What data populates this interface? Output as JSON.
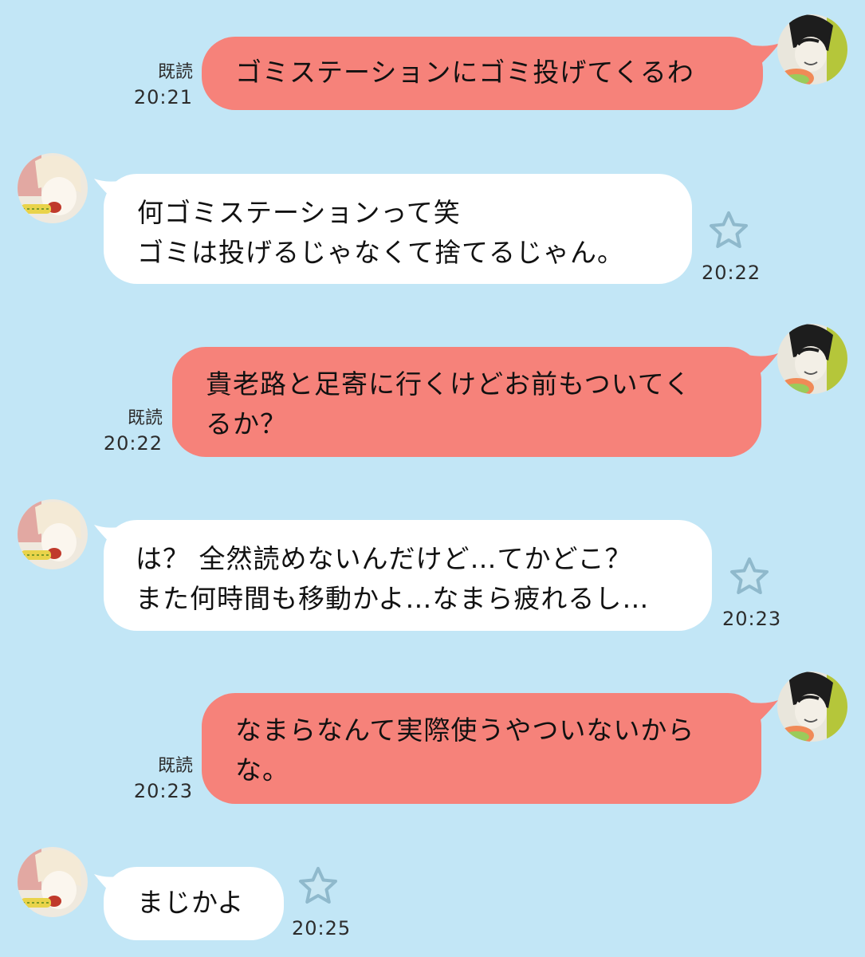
{
  "colors": {
    "background": "#c2e6f6",
    "outgoing_bubble": "#f6827a",
    "incoming_bubble": "#ffffff",
    "star_fill": "#c9e7f3",
    "star_stroke": "#8fb9cc"
  },
  "messages": [
    {
      "id": 1,
      "direction": "outgoing",
      "text": "ゴミステーションにゴミ投げてくるわ",
      "read_label": "既読",
      "time": "20:21",
      "avatar": "green-hair-man-avatar"
    },
    {
      "id": 2,
      "direction": "incoming",
      "text": "何ゴミステーションって笑\nゴミは投げるじゃなくて捨てるじゃん。",
      "time": "20:22",
      "avatar": "blonde-man-avatar",
      "reaction_icon": "star-icon"
    },
    {
      "id": 3,
      "direction": "outgoing",
      "text": "貴老路と足寄に行くけどお前もついてく\nるか？",
      "read_label": "既読",
      "time": "20:22",
      "avatar": "green-hair-man-avatar"
    },
    {
      "id": 4,
      "direction": "incoming",
      "text": "は？ 全然読めないんだけど…てかどこ？\nまた何時間も移動かよ…なまら疲れるし…",
      "time": "20:23",
      "avatar": "blonde-man-avatar",
      "reaction_icon": "star-icon"
    },
    {
      "id": 5,
      "direction": "outgoing",
      "text": "なまらなんて実際使うやついないから\nな。",
      "read_label": "既読",
      "time": "20:23",
      "avatar": "green-hair-man-avatar"
    },
    {
      "id": 6,
      "direction": "incoming",
      "text": "まじかよ",
      "time": "20:25",
      "avatar": "blonde-man-avatar",
      "reaction_icon": "star-icon"
    }
  ]
}
